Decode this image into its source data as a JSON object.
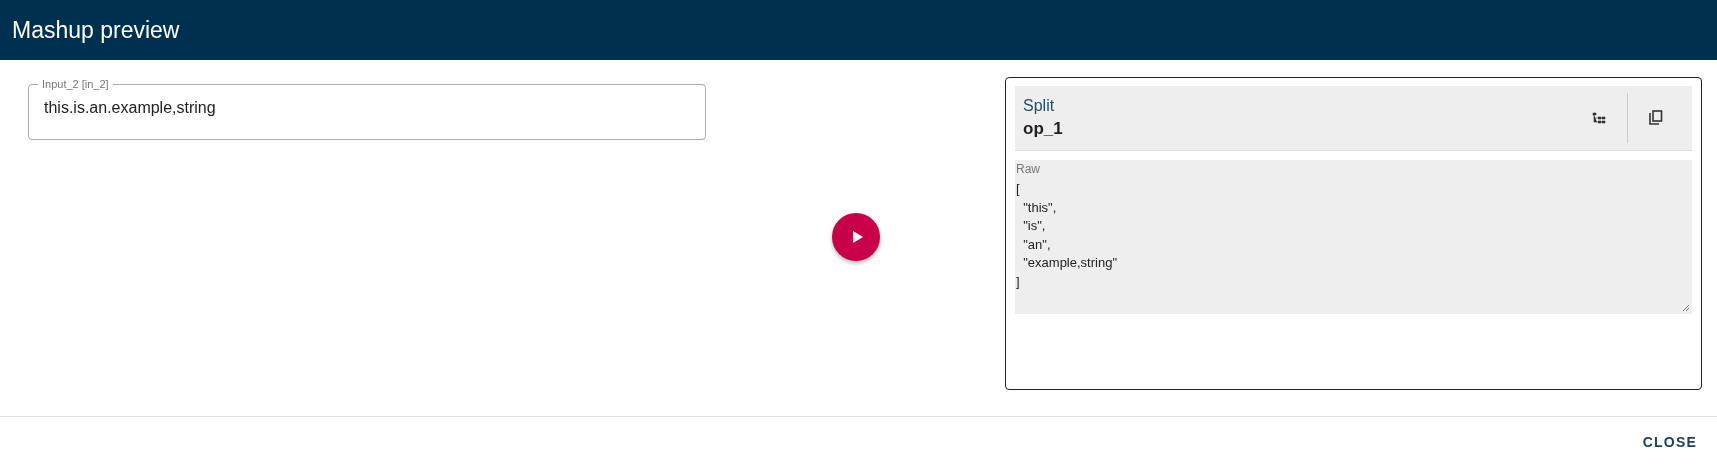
{
  "header": {
    "title": "Mashup preview"
  },
  "input": {
    "label": "Input_2 [in_2]",
    "value": "this.is.an.example,string"
  },
  "result": {
    "operation": "Split",
    "name": "op_1",
    "raw_label": "Raw",
    "raw_value": "[\n  \"this\",\n  \"is\",\n  \"an\",\n  \"example,string\"\n]"
  },
  "buttons": [
    "CLOSE"
  ]
}
